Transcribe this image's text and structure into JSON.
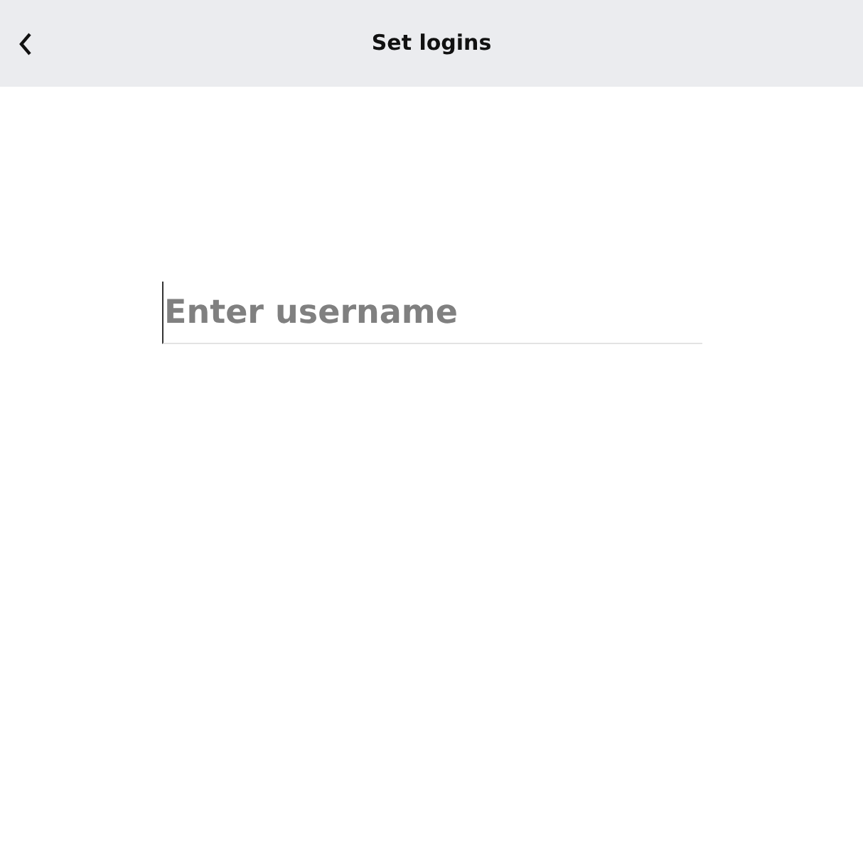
{
  "header": {
    "title": "Set logins"
  },
  "username_field": {
    "placeholder": "Enter username"
  }
}
